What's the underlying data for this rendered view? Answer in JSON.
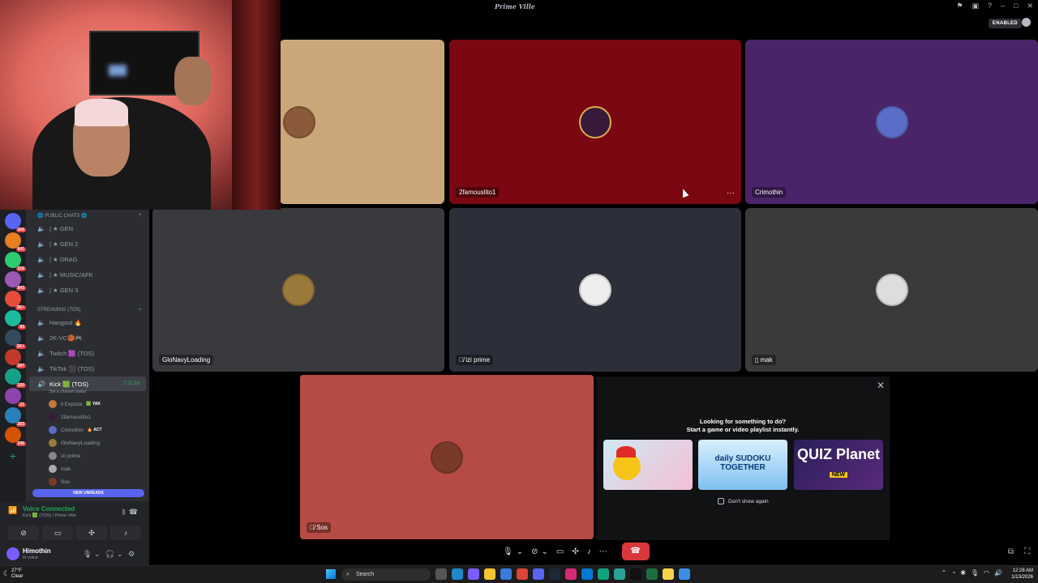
{
  "app": {
    "title": "Prime Ville",
    "enabled_badge": "ENABLED"
  },
  "tiles": [
    {
      "name": "",
      "bg": "#c9a77a",
      "avatar_color": "#8a5a3a"
    },
    {
      "name": "2famouslito1",
      "bg": "#7a0711",
      "avatar_color": "#3a1a3a"
    },
    {
      "name": "Crimothin",
      "bg": "#4a2468",
      "avatar_color": "#5a6ec8"
    },
    {
      "name": "GloNavyLoading",
      "bg": "#3a3a3e",
      "avatar_color": "#9a7a3a"
    },
    {
      "name": "izi prime",
      "bg": "#2c2f3a",
      "avatar_color": "#eeeeee"
    },
    {
      "name": "mak",
      "bg": "#3a3a3c",
      "avatar_color": "#dddddd"
    },
    {
      "name": "Sos",
      "bg": "#b64b43",
      "avatar_color": "#7a3a2a"
    }
  ],
  "more_icon": "···",
  "server_badges": [
    "166",
    "641",
    "216",
    "843",
    "3K+",
    "93",
    "1K+",
    "397",
    "100",
    "21",
    "263",
    "246"
  ],
  "sidebar": {
    "cat_public": "Public Chats",
    "public_channels": [
      {
        "label": "| ★ GEN"
      },
      {
        "label": "| ★ GEN 2"
      },
      {
        "label": "| ★ DRAG"
      },
      {
        "label": "| ★ MUSIC/AFK"
      },
      {
        "label": "| ★ GEN 3"
      }
    ],
    "cat_streaming": "STREAMING (TOS)",
    "stream_channels": [
      {
        "label": "Hangout 🔥"
      },
      {
        "label": "2K-VC🏀🎮"
      },
      {
        "label": "Twitch 🟪 (TOS)"
      },
      {
        "label": "TikTok ⬛ (TOS)"
      }
    ],
    "active_channel": {
      "label": "Kick 🟩 (TOS)",
      "time": "7:22:38",
      "status": "Set a channel status"
    },
    "voice_users": [
      {
        "name": "ll Expoze",
        "tag": "🟩 YAK",
        "color": "#c07a3a"
      },
      {
        "name": "2famouslito1",
        "tag": "",
        "color": "#3a1a3a"
      },
      {
        "name": "Crimothin",
        "tag": "🔥 ACT",
        "color": "#5a6ec8"
      },
      {
        "name": "GloNavyLoading",
        "tag": "",
        "color": "#9a7a3a"
      },
      {
        "name": "izi prime",
        "tag": "",
        "color": "#888888"
      },
      {
        "name": "mak",
        "tag": "",
        "color": "#aaaaaa"
      },
      {
        "name": "Sos",
        "tag": "",
        "color": "#7a3a2a"
      }
    ],
    "new_unreads": "NEW UNREADS"
  },
  "voice": {
    "connected": "Voice Connected",
    "sub": "Kick 🟩 (TOS) / Prime Ville"
  },
  "me": {
    "name": "Himothin",
    "status": "In voice"
  },
  "activity": {
    "heading1": "Looking for something to do?",
    "heading2": "Start a game or video playlist instantly.",
    "game2_label": "daily SUDOKU TOGETHER",
    "game3_label": "QUIZ Planet",
    "game3_badge": "NEW",
    "dont_show": "Don't show again"
  },
  "taskbar": {
    "temp": "27°F",
    "cond": "Clear",
    "search": "Search",
    "time": "12:28 AM",
    "date": "1/13/2026"
  }
}
